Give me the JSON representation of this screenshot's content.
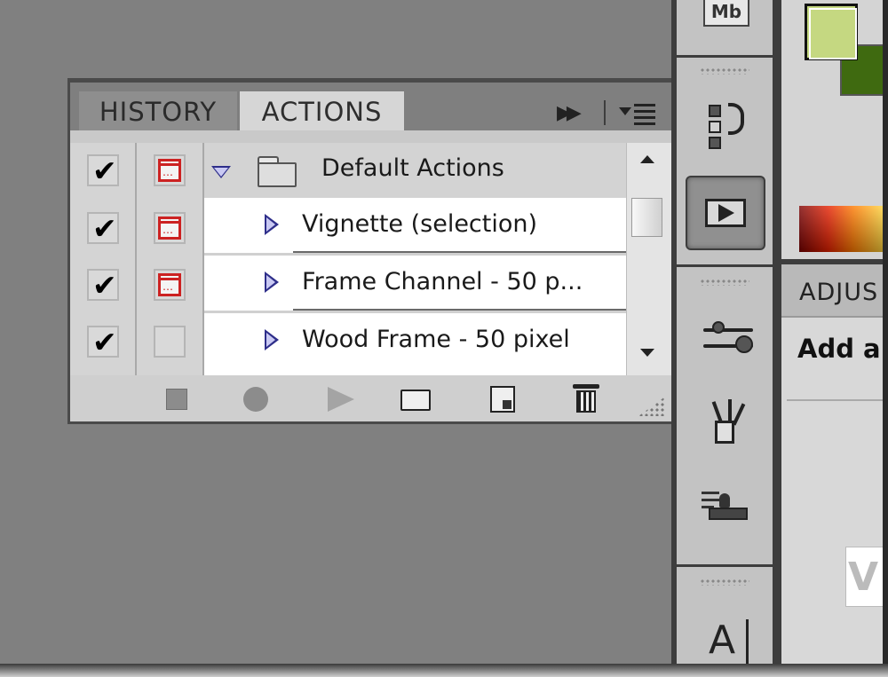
{
  "actions_panel": {
    "tabs": [
      {
        "label": "HISTORY",
        "active": false
      },
      {
        "label": "ACTIONS",
        "active": true
      }
    ],
    "set": {
      "label": "Default Actions",
      "expanded": true,
      "checked": true,
      "dialog_on": true
    },
    "actions": [
      {
        "label": "Vignette (selection)",
        "checked": true,
        "dialog_on": true
      },
      {
        "label": "Frame Channel - 50 p...",
        "checked": true,
        "dialog_on": true
      },
      {
        "label": "Wood Frame - 50 pixel",
        "checked": true,
        "dialog_on": false
      }
    ],
    "footer_icons": [
      "stop-icon",
      "record-icon",
      "play-icon",
      "new-set-icon",
      "new-action-icon",
      "delete-icon"
    ]
  },
  "dock": {
    "top_icon_label": "Mb",
    "icons": [
      "mini-bridge-icon",
      "history-icon",
      "actions-icon",
      "adjustments-icon",
      "brushes-icon",
      "clone-source-icon",
      "character-icon"
    ],
    "char_glyph": "A"
  },
  "adjustments_panel": {
    "tab_label": "ADJUS",
    "text": "Add a",
    "box_glyph": "V"
  },
  "colors": {
    "foreground": "#c5d881",
    "background": "#3f6a10",
    "panel_bg": "#808080",
    "dialog_icon": "#cc2222",
    "disclosure": "#2e2e8a"
  }
}
